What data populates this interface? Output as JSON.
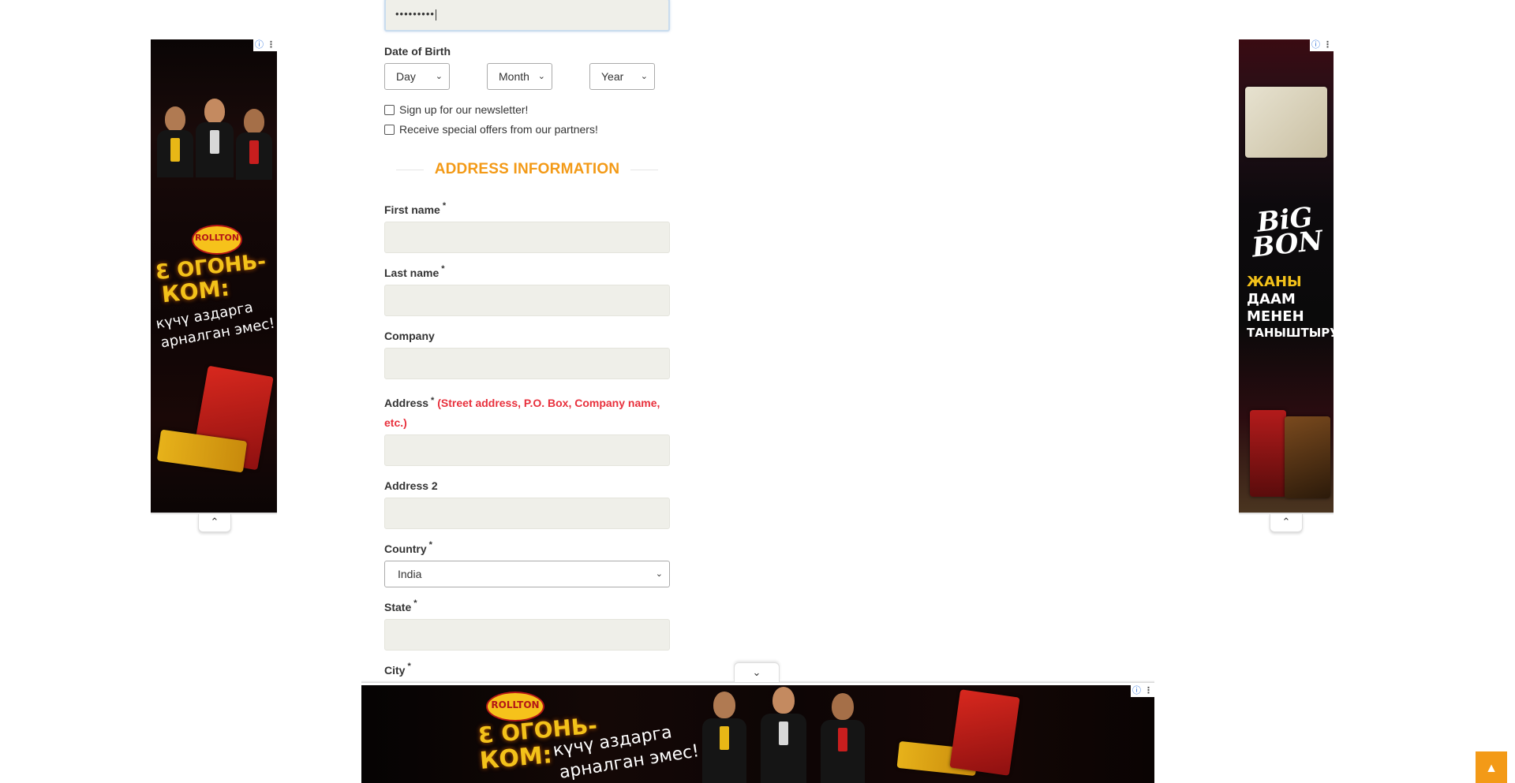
{
  "form": {
    "password_value": "•••••••••",
    "dob": {
      "label": "Date of Birth",
      "day": "Day",
      "month": "Month",
      "year": "Year"
    },
    "newsletter_label": "Sign up for our newsletter!",
    "offers_label": "Receive special offers from our partners!",
    "section_title": "ADDRESS INFORMATION",
    "required_mark": "*",
    "first_name_label": "First name",
    "last_name_label": "Last name",
    "company_label": "Company",
    "address_label": "Address",
    "address_hint_line1": "(Street address, P.O. Box, Company name,",
    "address_hint_line2": "etc.)",
    "address2_label": "Address 2",
    "country_label": "Country",
    "country_value": "India",
    "state_label": "State",
    "city_label": "City"
  },
  "ads": {
    "info_icon": "ⓘ",
    "more_icon": "⋮",
    "left": {
      "brand": "ROLLTON",
      "headline_1": "Ɛ ОГОНЬ-",
      "headline_2": "КОМ:",
      "sub_1": "күчү аздарга",
      "sub_2": "арналган эмес!"
    },
    "right": {
      "brand_1": "BiG",
      "brand_2": "BON",
      "line_1": "ЖАНЫ",
      "line_2": "ДААМ",
      "line_3": "МЕНЕН",
      "line_4": "ТАНЫШТЫРУУ"
    },
    "bottom": {
      "brand": "ROLLTON",
      "headline_1": "Ɛ ОГОНЬ-",
      "headline_2": "КОМ:",
      "sub_1": "күчү аздарга",
      "sub_2": "арналган эмес!"
    }
  },
  "icons": {
    "chevron_up": "⌃",
    "chevron_down": "⌄",
    "select_arrow": "⌄",
    "scroll_top": "▲"
  },
  "colors": {
    "accent_orange": "#f39a17",
    "hint_red": "#e8303c",
    "input_bg": "#efefe9"
  }
}
